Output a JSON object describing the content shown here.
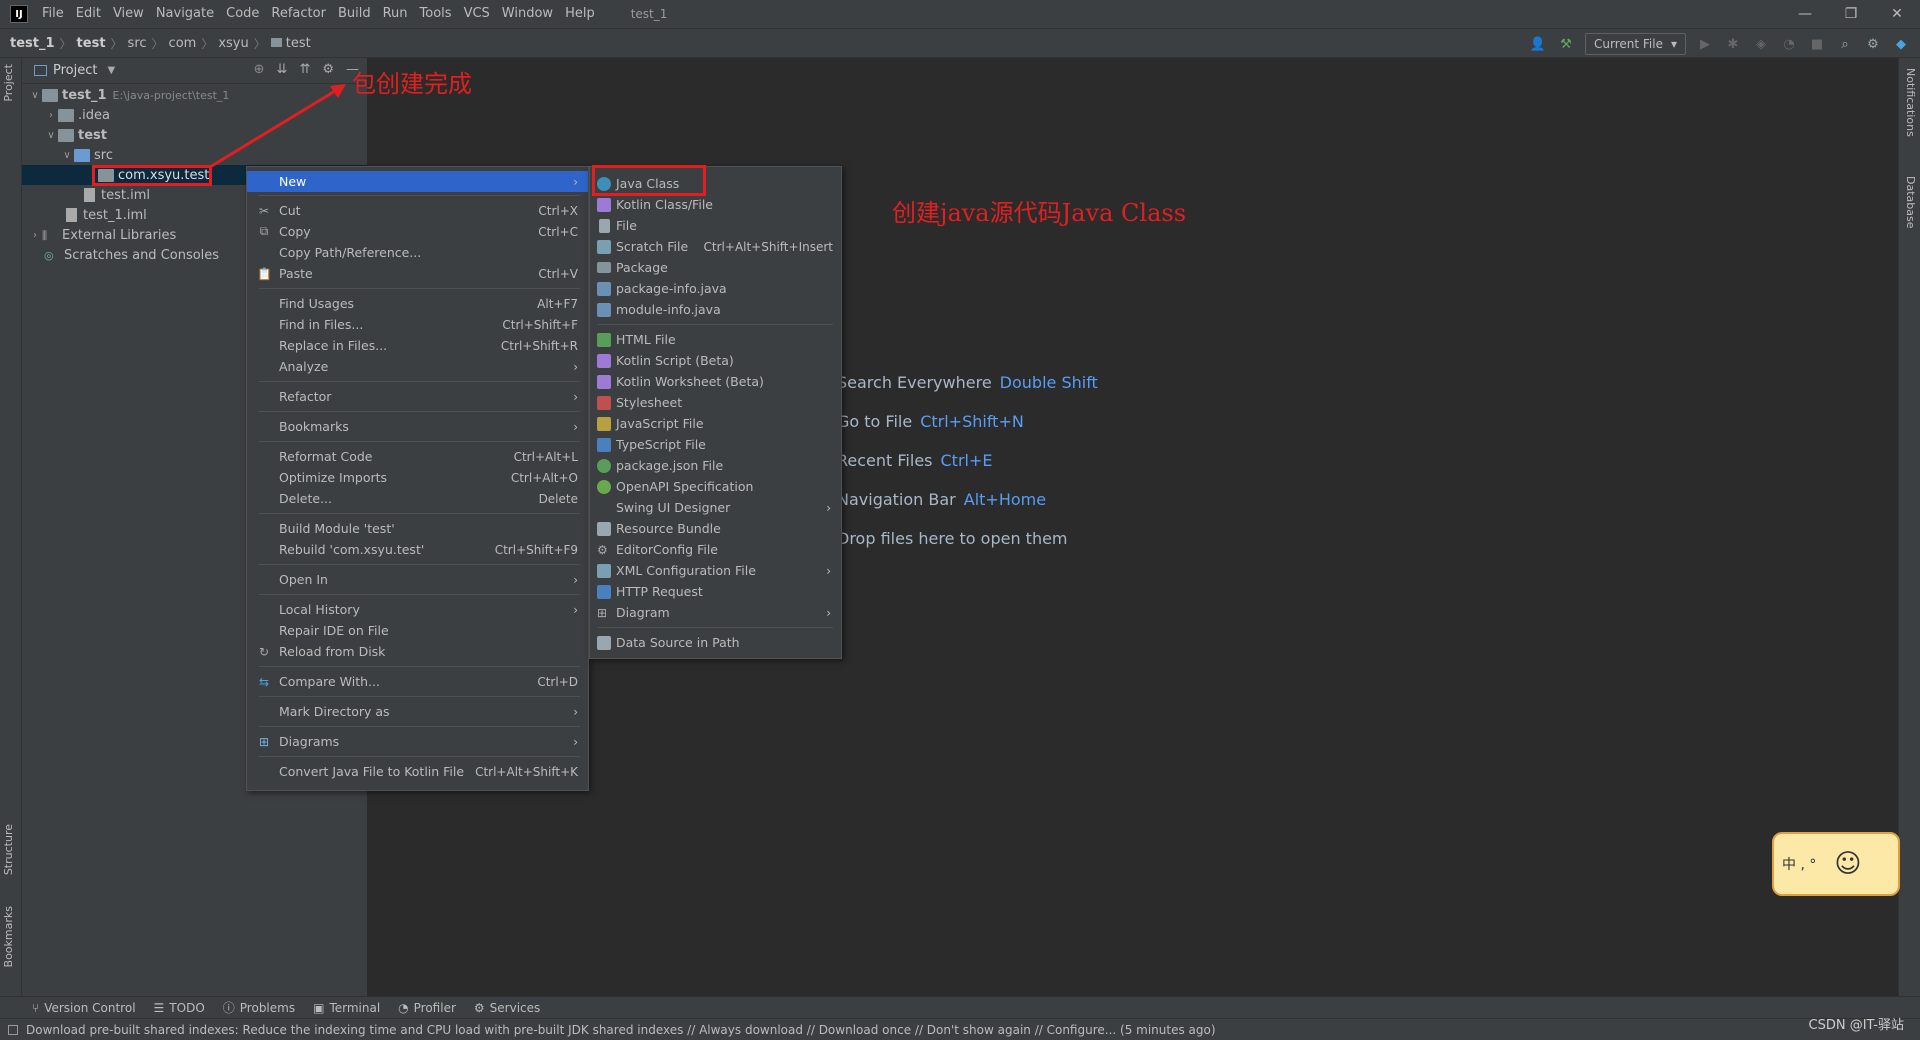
{
  "menubar": {
    "logo": "IJ",
    "items": [
      "File",
      "Edit",
      "View",
      "Navigate",
      "Code",
      "Refactor",
      "Build",
      "Run",
      "Tools",
      "VCS",
      "Window",
      "Help"
    ],
    "window_title": "test_1"
  },
  "window_controls": {
    "minimize": "—",
    "restore": "❐",
    "close": "✕"
  },
  "breadcrumb": [
    "test_1",
    "test",
    "src",
    "com",
    "xsyu",
    "test"
  ],
  "toolbar": {
    "run_config": "Current File"
  },
  "left_stripe": {
    "project": "Project",
    "structure": "Structure",
    "bookmarks": "Bookmarks"
  },
  "right_stripe": {
    "notifications": "Notifications",
    "database": "Database"
  },
  "project_panel": {
    "title": "Project",
    "tree": [
      {
        "label": "test_1",
        "hint": "E:\\java-project\\test_1"
      },
      {
        "label": ".idea"
      },
      {
        "label": "test"
      },
      {
        "label": "src"
      },
      {
        "label": "com.xsyu.test"
      },
      {
        "label": "test.iml"
      },
      {
        "label": "test_1.iml"
      },
      {
        "label": "External Libraries"
      },
      {
        "label": "Scratches and Consoles"
      }
    ]
  },
  "context_menu": {
    "items": [
      {
        "label": "New",
        "shortcut": "",
        "arrow": "›"
      },
      {
        "label": "Cut",
        "shortcut": "Ctrl+X"
      },
      {
        "label": "Copy",
        "shortcut": "Ctrl+C"
      },
      {
        "label": "Copy Path/Reference...",
        "shortcut": ""
      },
      {
        "label": "Paste",
        "shortcut": "Ctrl+V"
      },
      {
        "label": "Find Usages",
        "shortcut": "Alt+F7"
      },
      {
        "label": "Find in Files...",
        "shortcut": "Ctrl+Shift+F"
      },
      {
        "label": "Replace in Files...",
        "shortcut": "Ctrl+Shift+R"
      },
      {
        "label": "Analyze",
        "arrow": "›"
      },
      {
        "label": "Refactor",
        "arrow": "›"
      },
      {
        "label": "Bookmarks",
        "arrow": "›"
      },
      {
        "label": "Reformat Code",
        "shortcut": "Ctrl+Alt+L"
      },
      {
        "label": "Optimize Imports",
        "shortcut": "Ctrl+Alt+O"
      },
      {
        "label": "Delete...",
        "shortcut": "Delete"
      },
      {
        "label": "Build Module 'test'",
        "shortcut": ""
      },
      {
        "label": "Rebuild 'com.xsyu.test'",
        "shortcut": "Ctrl+Shift+F9"
      },
      {
        "label": "Open In",
        "arrow": "›"
      },
      {
        "label": "Local History",
        "arrow": "›"
      },
      {
        "label": "Repair IDE on File",
        "shortcut": ""
      },
      {
        "label": "Reload from Disk",
        "shortcut": ""
      },
      {
        "label": "Compare With...",
        "shortcut": "Ctrl+D"
      },
      {
        "label": "Mark Directory as",
        "arrow": "›"
      },
      {
        "label": "Diagrams",
        "arrow": "›"
      },
      {
        "label": "Convert Java File to Kotlin File",
        "shortcut": "Ctrl+Alt+Shift+K"
      }
    ]
  },
  "new_submenu": {
    "items": [
      {
        "label": "Java Class",
        "shortcut": ""
      },
      {
        "label": "Kotlin Class/File",
        "shortcut": ""
      },
      {
        "label": "File",
        "shortcut": ""
      },
      {
        "label": "Scratch File",
        "shortcut": "Ctrl+Alt+Shift+Insert"
      },
      {
        "label": "Package",
        "shortcut": ""
      },
      {
        "label": "package-info.java",
        "shortcut": ""
      },
      {
        "label": "module-info.java",
        "shortcut": ""
      },
      {
        "label": "HTML File",
        "shortcut": ""
      },
      {
        "label": "Kotlin Script (Beta)",
        "shortcut": ""
      },
      {
        "label": "Kotlin Worksheet (Beta)",
        "shortcut": ""
      },
      {
        "label": "Stylesheet",
        "shortcut": ""
      },
      {
        "label": "JavaScript File",
        "shortcut": ""
      },
      {
        "label": "TypeScript File",
        "shortcut": ""
      },
      {
        "label": "package.json File",
        "shortcut": ""
      },
      {
        "label": "OpenAPI Specification",
        "shortcut": ""
      },
      {
        "label": "Swing UI Designer",
        "arrow": "›"
      },
      {
        "label": "Resource Bundle",
        "shortcut": ""
      },
      {
        "label": "EditorConfig File",
        "shortcut": ""
      },
      {
        "label": "XML Configuration File",
        "arrow": "›"
      },
      {
        "label": "HTTP Request",
        "shortcut": ""
      },
      {
        "label": "Diagram",
        "arrow": "›"
      },
      {
        "label": "Data Source in Path",
        "shortcut": ""
      }
    ]
  },
  "editor_hints": [
    {
      "text": "Search Everywhere",
      "key": "Double Shift"
    },
    {
      "text": "Go to File",
      "key": "Ctrl+Shift+N"
    },
    {
      "text": "Recent Files",
      "key": "Ctrl+E"
    },
    {
      "text": "Navigation Bar",
      "key": "Alt+Home"
    },
    {
      "text": "Drop files here to open them",
      "key": ""
    }
  ],
  "annotations": {
    "package_created": "包创建完成",
    "create_java_class": "创建java源代码Java Class"
  },
  "tool_tabs": [
    "Version Control",
    "TODO",
    "Problems",
    "Terminal",
    "Profiler",
    "Services"
  ],
  "status_bar": {
    "message": "Download pre-built shared indexes: Reduce the indexing time and CPU load with pre-built JDK shared indexes // Always download // Download once // Don't show again // Configure... (5 minutes ago)"
  },
  "watermark": "CSDN @IT-驿站",
  "ime_sticker": "中 , °",
  "colors": {
    "accent": "#2f65ca",
    "annotation": "#e02020",
    "link_key": "#589df6",
    "panel": "#3c3f41",
    "editor": "#2b2b2b"
  }
}
